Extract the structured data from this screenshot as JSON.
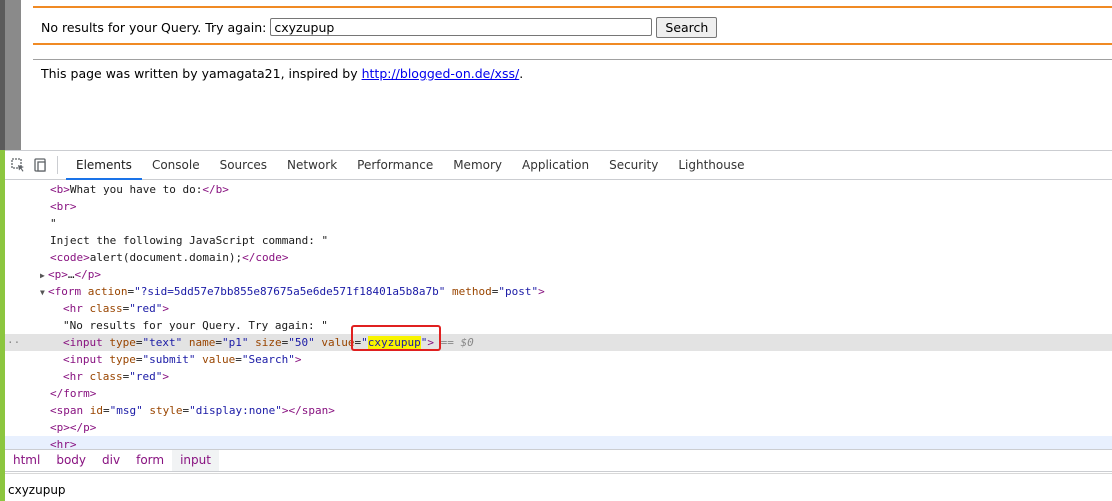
{
  "page": {
    "query_label": "No results for your Query. Try again:",
    "query_value": "cxyzupup",
    "search_button": "Search",
    "credit_prefix": "This page was written by yamagata21, inspired by ",
    "credit_link": "http://blogged-on.de/xss/",
    "credit_suffix": "."
  },
  "devtools": {
    "tabs": [
      "Elements",
      "Console",
      "Sources",
      "Network",
      "Performance",
      "Memory",
      "Application",
      "Security",
      "Lighthouse"
    ],
    "active_tab": "Elements",
    "code": {
      "l1_open": "<b>",
      "l1_text": "What you have to do:",
      "l1_close": "</b>",
      "l2": "<br>",
      "l3": "\"",
      "l4": "Inject the following JavaScript command: \"",
      "l5_open": "<code>",
      "l5_text": "alert(document.domain);",
      "l5_close": "</code>",
      "l6_open": "<p>",
      "l6_ellipsis": "…",
      "l6_close": "</p>",
      "l7_tag": "<form",
      "l7_attr1": "action",
      "l7_val1": "\"?sid=5dd57e7bb855e87675a5e6de571f18401a5b8a7b\"",
      "l7_attr2": "method",
      "l7_val2": "\"post\"",
      "l7_end": ">",
      "l8_tag": "<hr",
      "l8_attr": "class",
      "l8_val": "\"red\"",
      "l8_end": ">",
      "l9": "\"No results for your Query. Try again: \"",
      "l10_tag": "<input",
      "l10_a1": "type",
      "l10_v1": "\"text\"",
      "l10_a2": "name",
      "l10_v2": "\"p1\"",
      "l10_a3": "size",
      "l10_v3": "\"50\"",
      "l10_a4": "value",
      "l10_q": "\"",
      "l10_hl": "cxyzupup",
      "l10_end": ">",
      "l10_ref": "== $0",
      "l11_tag": "<input",
      "l11_a1": "type",
      "l11_v1": "\"submit\"",
      "l11_a2": "value",
      "l11_v2": "\"Search\"",
      "l11_end": ">",
      "l12_tag": "<hr",
      "l12_attr": "class",
      "l12_val": "\"red\"",
      "l12_end": ">",
      "l13": "</form>",
      "l14_tag": "<span",
      "l14_a1": "id",
      "l14_v1": "\"msg\"",
      "l14_a2": "style",
      "l14_v2": "\"display:none\"",
      "l14_end": "></span>",
      "l15_open": "<p>",
      "l15_close": "</p>",
      "l16": "<hr>"
    },
    "breadcrumbs": [
      "html",
      "body",
      "div",
      "form",
      "input"
    ],
    "active_crumb": "input",
    "status_value": "cxyzupup"
  },
  "colors": {
    "accent_orange": "#f08a24",
    "tab_underline": "#1a73e8",
    "highlight_box": "#e02020",
    "search_highlight": "#f8f400"
  }
}
